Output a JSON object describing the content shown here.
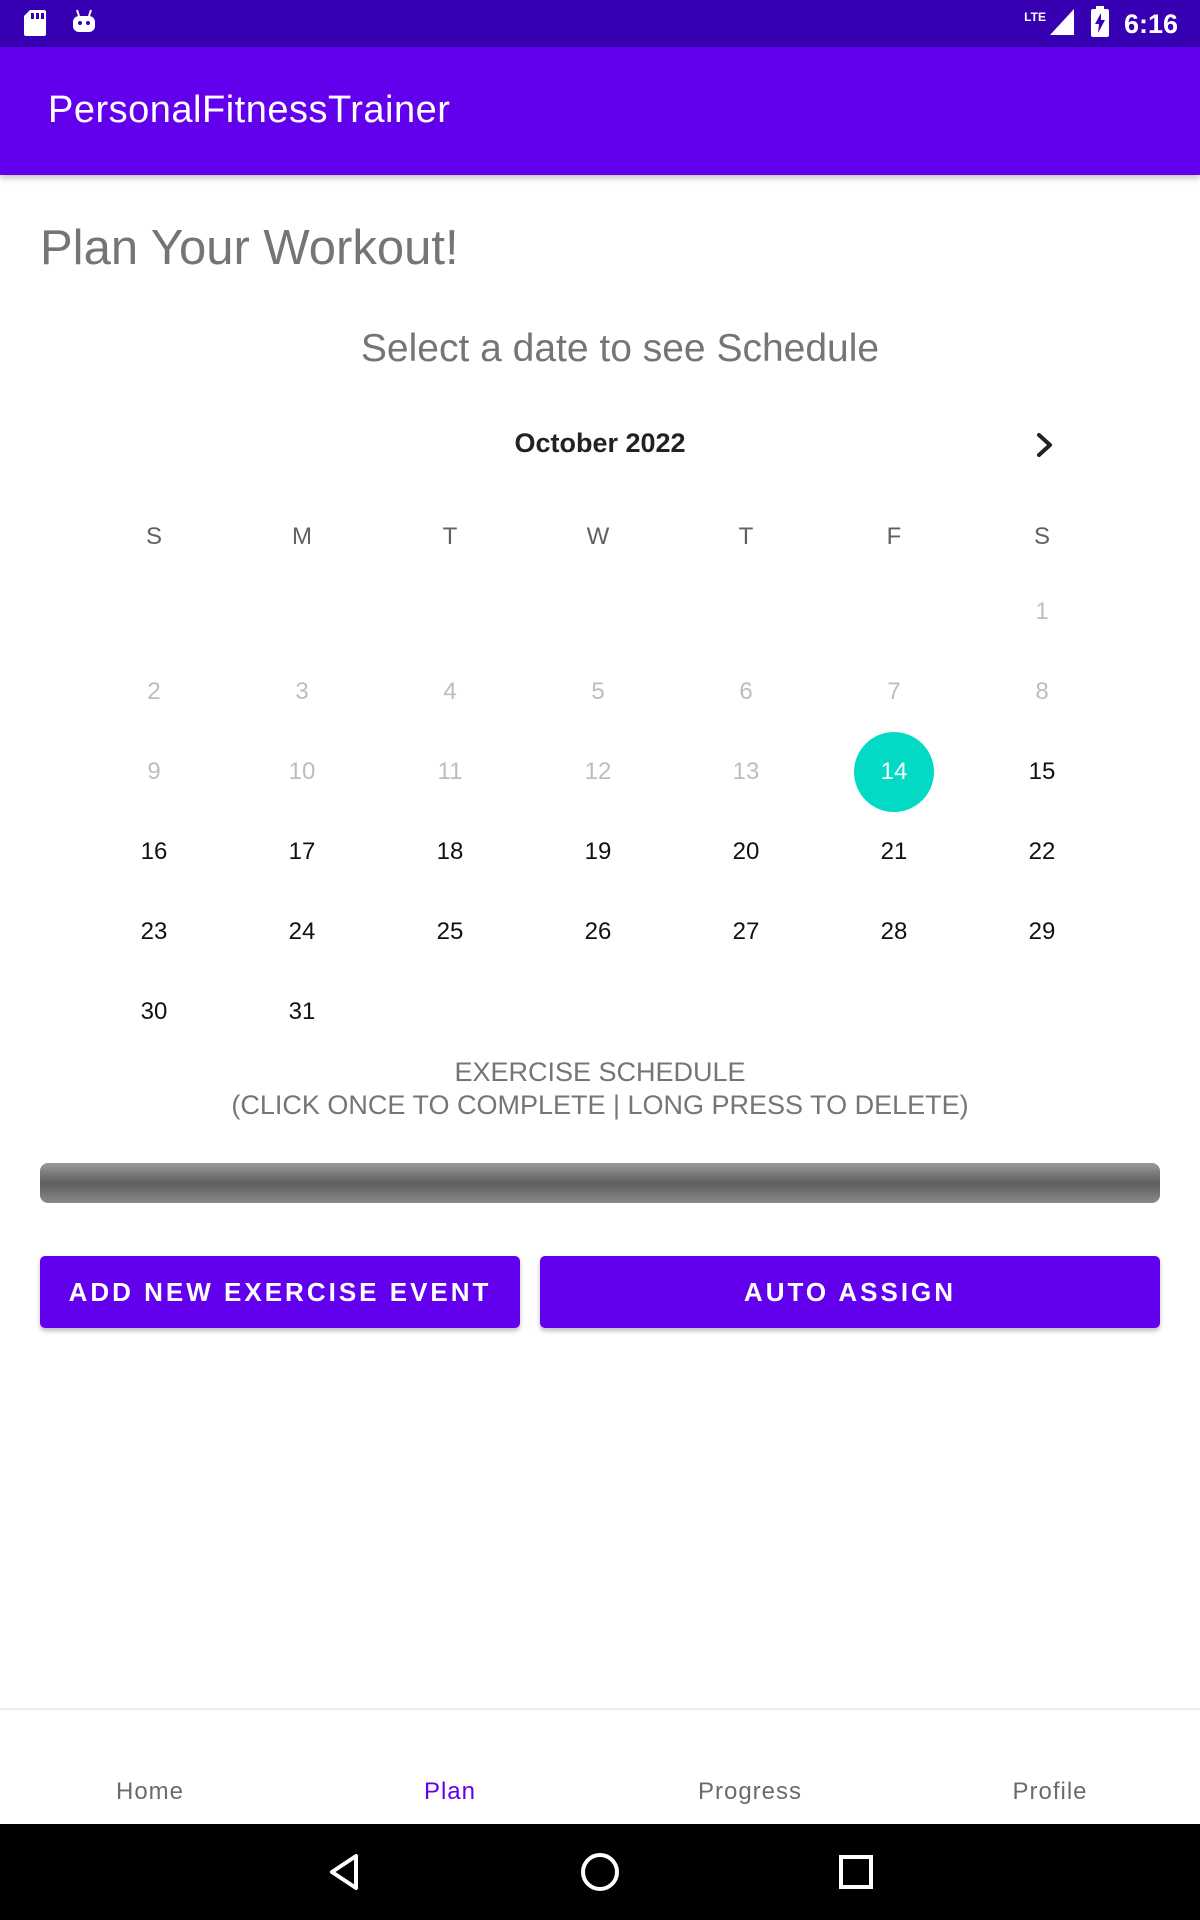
{
  "status_bar": {
    "time": "6:16",
    "network": "LTE",
    "icons": [
      "sd-card-icon",
      "android-icon",
      "signal-icon",
      "battery-charging-icon"
    ]
  },
  "app_bar": {
    "title": "PersonalFitnessTrainer"
  },
  "page": {
    "heading": "Plan Your Workout!",
    "subheading": "Select a date to see Schedule"
  },
  "calendar": {
    "month_label": "October 2022",
    "weekdays": [
      "S",
      "M",
      "T",
      "W",
      "T",
      "F",
      "S"
    ],
    "selected_day": "14",
    "days": {
      "d1": "1",
      "d2": "2",
      "d3": "3",
      "d4": "4",
      "d5": "5",
      "d6": "6",
      "d7": "7",
      "d8": "8",
      "d9": "9",
      "d10": "10",
      "d11": "11",
      "d12": "12",
      "d13": "13",
      "d14": "14",
      "d15": "15",
      "d16": "16",
      "d17": "17",
      "d18": "18",
      "d19": "19",
      "d20": "20",
      "d21": "21",
      "d22": "22",
      "d23": "23",
      "d24": "24",
      "d25": "25",
      "d26": "26",
      "d27": "27",
      "d28": "28",
      "d29": "29",
      "d30": "30",
      "d31": "31"
    }
  },
  "schedule": {
    "title": "EXERCISE SCHEDULE",
    "hint": "(CLICK ONCE TO COMPLETE | LONG PRESS TO DELETE)"
  },
  "buttons": {
    "add_label": "ADD NEW EXERCISE EVENT",
    "auto_label": "AUTO ASSIGN"
  },
  "bottom_nav": {
    "home": "Home",
    "plan": "Plan",
    "progress": "Progress",
    "profile": "Profile",
    "active": "Plan"
  },
  "colors": {
    "primary": "#6200ee",
    "primary_dark": "#3700b3",
    "accent": "#03dac5"
  }
}
